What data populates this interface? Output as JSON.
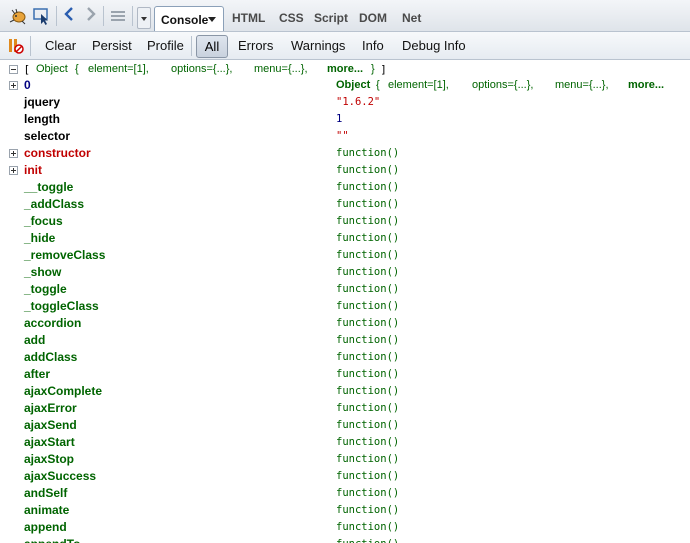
{
  "toolbar": {
    "firebug_icon": "firebug-icon",
    "inspect_icon": "inspect-icon",
    "panel_tabs": [
      {
        "label": "Console",
        "active": true
      },
      {
        "label": "HTML"
      },
      {
        "label": "CSS"
      },
      {
        "label": "Script"
      },
      {
        "label": "DOM"
      },
      {
        "label": "Net"
      }
    ]
  },
  "console_toolbar": {
    "clear": "Clear",
    "persist": "Persist",
    "profile": "Profile",
    "filters": [
      "All",
      "Errors",
      "Warnings",
      "Info",
      "Debug Info"
    ]
  },
  "summary": {
    "open": "[",
    "object": "Object",
    "brace_open": "{",
    "element": "element=[1],",
    "options": "options={...},",
    "menu": "menu={...},",
    "more": "more...",
    "brace_close": "}",
    "close": "]"
  },
  "first_value": {
    "object": "Object",
    "brace_open": "{",
    "element": "element=[1],",
    "options": "options={...},",
    "menu": "menu={...},",
    "more": "more..."
  },
  "rows": [
    {
      "name": "0",
      "value": "",
      "expand": true,
      "name_color": "navy",
      "value_type": "object"
    },
    {
      "name": "jquery",
      "value": "\"1.6.2\"",
      "name_color": "blk",
      "value_type": "string"
    },
    {
      "name": "length",
      "value": "1",
      "name_color": "blk",
      "value_type": "number"
    },
    {
      "name": "selector",
      "value": "\"\"",
      "name_color": "blk",
      "value_type": "string"
    },
    {
      "name": "constructor",
      "value": "function()",
      "expand": true,
      "name_color": "red",
      "value_type": "func"
    },
    {
      "name": "init",
      "value": "function()",
      "expand": true,
      "name_color": "red",
      "value_type": "func"
    },
    {
      "name": "__toggle",
      "value": "function()",
      "name_color": "green",
      "value_type": "func"
    },
    {
      "name": "_addClass",
      "value": "function()",
      "name_color": "green",
      "value_type": "func"
    },
    {
      "name": "_focus",
      "value": "function()",
      "name_color": "green",
      "value_type": "func"
    },
    {
      "name": "_hide",
      "value": "function()",
      "name_color": "green",
      "value_type": "func"
    },
    {
      "name": "_removeClass",
      "value": "function()",
      "name_color": "green",
      "value_type": "func"
    },
    {
      "name": "_show",
      "value": "function()",
      "name_color": "green",
      "value_type": "func"
    },
    {
      "name": "_toggle",
      "value": "function()",
      "name_color": "green",
      "value_type": "func"
    },
    {
      "name": "_toggleClass",
      "value": "function()",
      "name_color": "green",
      "value_type": "func"
    },
    {
      "name": "accordion",
      "value": "function()",
      "name_color": "green",
      "value_type": "func"
    },
    {
      "name": "add",
      "value": "function()",
      "name_color": "green",
      "value_type": "func"
    },
    {
      "name": "addClass",
      "value": "function()",
      "name_color": "green",
      "value_type": "func"
    },
    {
      "name": "after",
      "value": "function()",
      "name_color": "green",
      "value_type": "func"
    },
    {
      "name": "ajaxComplete",
      "value": "function()",
      "name_color": "green",
      "value_type": "func"
    },
    {
      "name": "ajaxError",
      "value": "function()",
      "name_color": "green",
      "value_type": "func"
    },
    {
      "name": "ajaxSend",
      "value": "function()",
      "name_color": "green",
      "value_type": "func"
    },
    {
      "name": "ajaxStart",
      "value": "function()",
      "name_color": "green",
      "value_type": "func"
    },
    {
      "name": "ajaxStop",
      "value": "function()",
      "name_color": "green",
      "value_type": "func"
    },
    {
      "name": "ajaxSuccess",
      "value": "function()",
      "name_color": "green",
      "value_type": "func"
    },
    {
      "name": "andSelf",
      "value": "function()",
      "name_color": "green",
      "value_type": "func"
    },
    {
      "name": "animate",
      "value": "function()",
      "name_color": "green",
      "value_type": "func"
    },
    {
      "name": "append",
      "value": "function()",
      "name_color": "green",
      "value_type": "func"
    },
    {
      "name": "appendTo",
      "value": "function()",
      "name_color": "green",
      "value_type": "func"
    }
  ],
  "colors": {
    "func": "#006400",
    "string": "#c00000",
    "red_name": "#c00000",
    "navy": "#000080"
  }
}
